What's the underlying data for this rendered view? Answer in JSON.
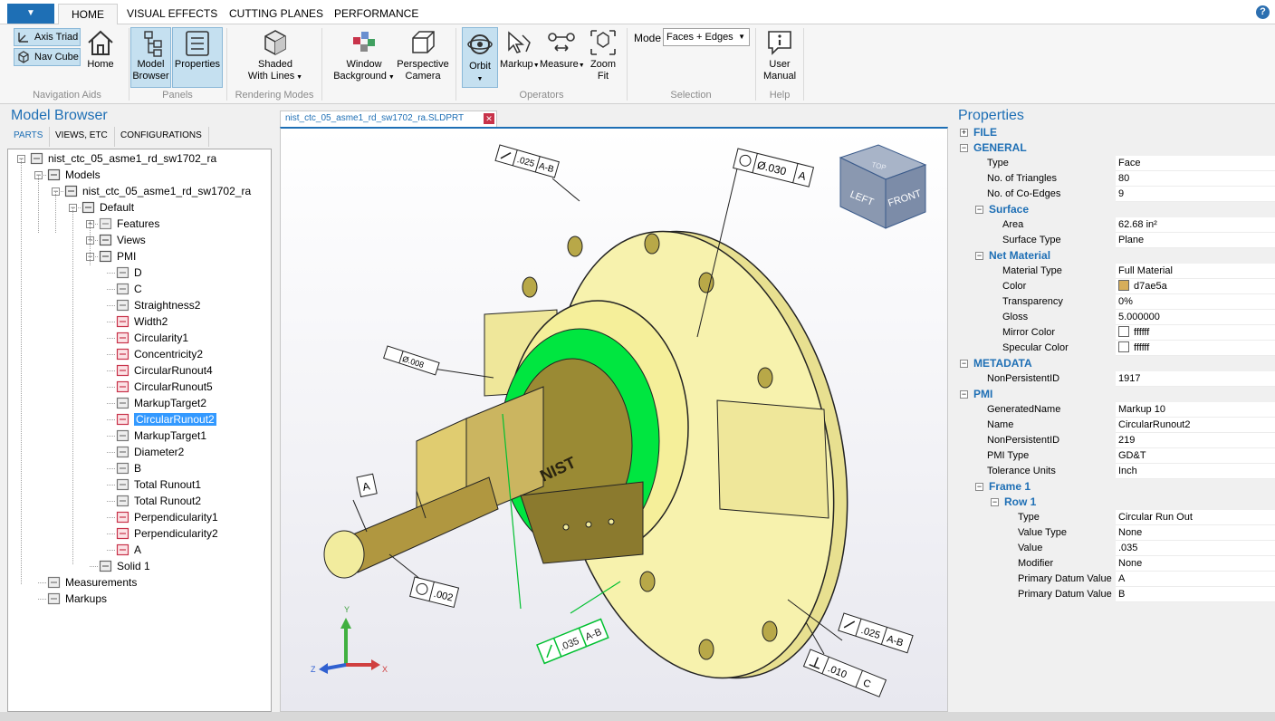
{
  "ribbon_tabs": [
    "HOME",
    "VISUAL EFFECTS",
    "CUTTING PLANES",
    "PERFORMANCE"
  ],
  "ribbon": {
    "nav_aids": {
      "axis_triad": "Axis Triad",
      "nav_cube": "Nav Cube",
      "home": "Home",
      "label": "Navigation Aids"
    },
    "panels": {
      "model_browser_1": "Model",
      "model_browser_2": "Browser",
      "properties": "Properties",
      "label": "Panels"
    },
    "rendering": {
      "shaded_1": "Shaded",
      "shaded_2": "With Lines",
      "label": "Rendering Modes"
    },
    "window_bg": {
      "l1": "Window",
      "l2": "Background"
    },
    "camera": {
      "l1": "Perspective",
      "l2": "Camera"
    },
    "operators": {
      "orbit": "Orbit",
      "markup": "Markup",
      "measure": "Measure",
      "zoom_1": "Zoom",
      "zoom_2": "Fit",
      "label": "Operators"
    },
    "selection": {
      "mode_label": "Mode",
      "mode_value": "Faces + Edges",
      "label": "Selection"
    },
    "help": {
      "l1": "User",
      "l2": "Manual",
      "label": "Help"
    }
  },
  "colors": {
    "accent": "#1e6fb5",
    "selection": "#3399ff",
    "part": "#f5f0a8",
    "highlight_face": "#00e640"
  },
  "browser": {
    "title": "Model Browser",
    "tabs": [
      "PARTS",
      "VIEWS, ETC",
      "CONFIGURATIONS"
    ],
    "tree": [
      {
        "label": "nist_ctc_05_asme1_rd_sw1702_ra",
        "icon": "part-icon"
      },
      {
        "label": "Models",
        "icon": "models-icon"
      },
      {
        "label": "nist_ctc_05_asme1_rd_sw1702_ra",
        "icon": "model-icon"
      },
      {
        "label": "Default",
        "icon": "config-icon"
      },
      {
        "label": "Features",
        "icon": "folder-icon"
      },
      {
        "label": "Views",
        "icon": "views-icon"
      },
      {
        "label": "PMI",
        "icon": "pmi-icon"
      },
      {
        "label": "D",
        "icon": "datum-icon"
      },
      {
        "label": "C",
        "icon": "datum-icon"
      },
      {
        "label": "Straightness2",
        "icon": "gdt-icon"
      },
      {
        "label": "Width2",
        "icon": "dimension-icon"
      },
      {
        "label": "Circularity1",
        "icon": "gdt-red-icon"
      },
      {
        "label": "Concentricity2",
        "icon": "gdt-red-icon"
      },
      {
        "label": "CircularRunout4",
        "icon": "gdt-red-icon"
      },
      {
        "label": "CircularRunout5",
        "icon": "gdt-red-icon"
      },
      {
        "label": "MarkupTarget2",
        "icon": "target-icon"
      },
      {
        "label": "CircularRunout2",
        "icon": "gdt-red-icon"
      },
      {
        "label": "MarkupTarget1",
        "icon": "target-icon"
      },
      {
        "label": "Diameter2",
        "icon": "diameter-icon"
      },
      {
        "label": "B",
        "icon": "datum-icon"
      },
      {
        "label": "Total Runout1",
        "icon": "gdt-icon"
      },
      {
        "label": "Total Runout2",
        "icon": "gdt-icon"
      },
      {
        "label": "Perpendicularity1",
        "icon": "gdt-red-icon"
      },
      {
        "label": "Perpendicularity2",
        "icon": "gdt-red-icon"
      },
      {
        "label": "A",
        "icon": "datum-red-icon"
      },
      {
        "label": "Solid 1",
        "icon": "solid-icon"
      },
      {
        "label": "Measurements",
        "icon": "measurements-icon"
      },
      {
        "label": "Markups",
        "icon": "markups-icon"
      }
    ],
    "selected_label": "CircularRunout2"
  },
  "document_tab": "nist_ctc_05_asme1_rd_sw1702_ra.SLDPRT",
  "viewport": {
    "navcube": {
      "top": "TOP",
      "left": "LEFT",
      "front": "FRONT"
    },
    "triad": {
      "y": "Y",
      "z": "Z",
      "x": "X"
    },
    "fcf": {
      "top_left_value": ".025",
      "top_left_datum": "A-B",
      "top_diam_value": "Ø.030",
      "top_diam_datum": "A",
      "straight_value": "Ø.008",
      "datum_a": "A",
      "circ_value": ".002",
      "runout_value": ".035",
      "runout_datum": "A-B",
      "perp_value": ".010",
      "perp_datum": "C",
      "right_value": ".025",
      "right_datum": "A-B",
      "logo": "NIST"
    }
  },
  "properties": {
    "title": "Properties",
    "rows": [
      {
        "key": "FILE",
        "type": "section",
        "indent": 0,
        "exp": "+"
      },
      {
        "key": "GENERAL",
        "type": "section",
        "indent": 0,
        "exp": "−"
      },
      {
        "key": "Type",
        "value": "Face",
        "indent": 1
      },
      {
        "key": "No. of Triangles",
        "value": "80",
        "indent": 1
      },
      {
        "key": "No. of Co-Edges",
        "value": "9",
        "indent": 1
      },
      {
        "key": "Surface",
        "type": "section",
        "indent": 1,
        "exp": "−"
      },
      {
        "key": "Area",
        "value": "62.68 in²",
        "indent": 2
      },
      {
        "key": "Surface Type",
        "value": "Plane",
        "indent": 2
      },
      {
        "key": "Net Material",
        "type": "section",
        "indent": 1,
        "exp": "−"
      },
      {
        "key": "Material Type",
        "value": "Full Material",
        "indent": 2
      },
      {
        "key": "Color",
        "value": "d7ae5a",
        "swatch": "#d7ae5a",
        "indent": 2
      },
      {
        "key": "Transparency",
        "value": "0%",
        "indent": 2
      },
      {
        "key": "Gloss",
        "value": "5.000000",
        "indent": 2
      },
      {
        "key": "Mirror Color",
        "value": "ffffff",
        "swatch": "#ffffff",
        "indent": 2
      },
      {
        "key": "Specular Color",
        "value": "ffffff",
        "swatch": "#ffffff",
        "indent": 2
      },
      {
        "key": "METADATA",
        "type": "section",
        "indent": 0,
        "exp": "−"
      },
      {
        "key": "NonPersistentID",
        "value": "1917",
        "indent": 1
      },
      {
        "key": "PMI",
        "type": "section",
        "indent": 0,
        "exp": "−"
      },
      {
        "key": "GeneratedName",
        "value": "Markup 10",
        "indent": 1
      },
      {
        "key": "Name",
        "value": "CircularRunout2",
        "indent": 1
      },
      {
        "key": "NonPersistentID",
        "value": "219",
        "indent": 1
      },
      {
        "key": "PMI Type",
        "value": "GD&T",
        "indent": 1
      },
      {
        "key": "Tolerance Units",
        "value": "Inch",
        "indent": 1
      },
      {
        "key": "Frame 1",
        "type": "section",
        "indent": 1,
        "exp": "−"
      },
      {
        "key": "Row 1",
        "type": "section",
        "indent": 2,
        "exp": "−"
      },
      {
        "key": "Type",
        "value": "Circular Run Out",
        "indent": 3
      },
      {
        "key": "Value Type",
        "value": "None",
        "indent": 3
      },
      {
        "key": "Value",
        "value": ".035",
        "indent": 3
      },
      {
        "key": "Modifier",
        "value": "None",
        "indent": 3
      },
      {
        "key": "Primary Datum Value",
        "value": "A",
        "indent": 3
      },
      {
        "key": "Primary Datum Value",
        "value": "B",
        "indent": 3
      }
    ]
  }
}
